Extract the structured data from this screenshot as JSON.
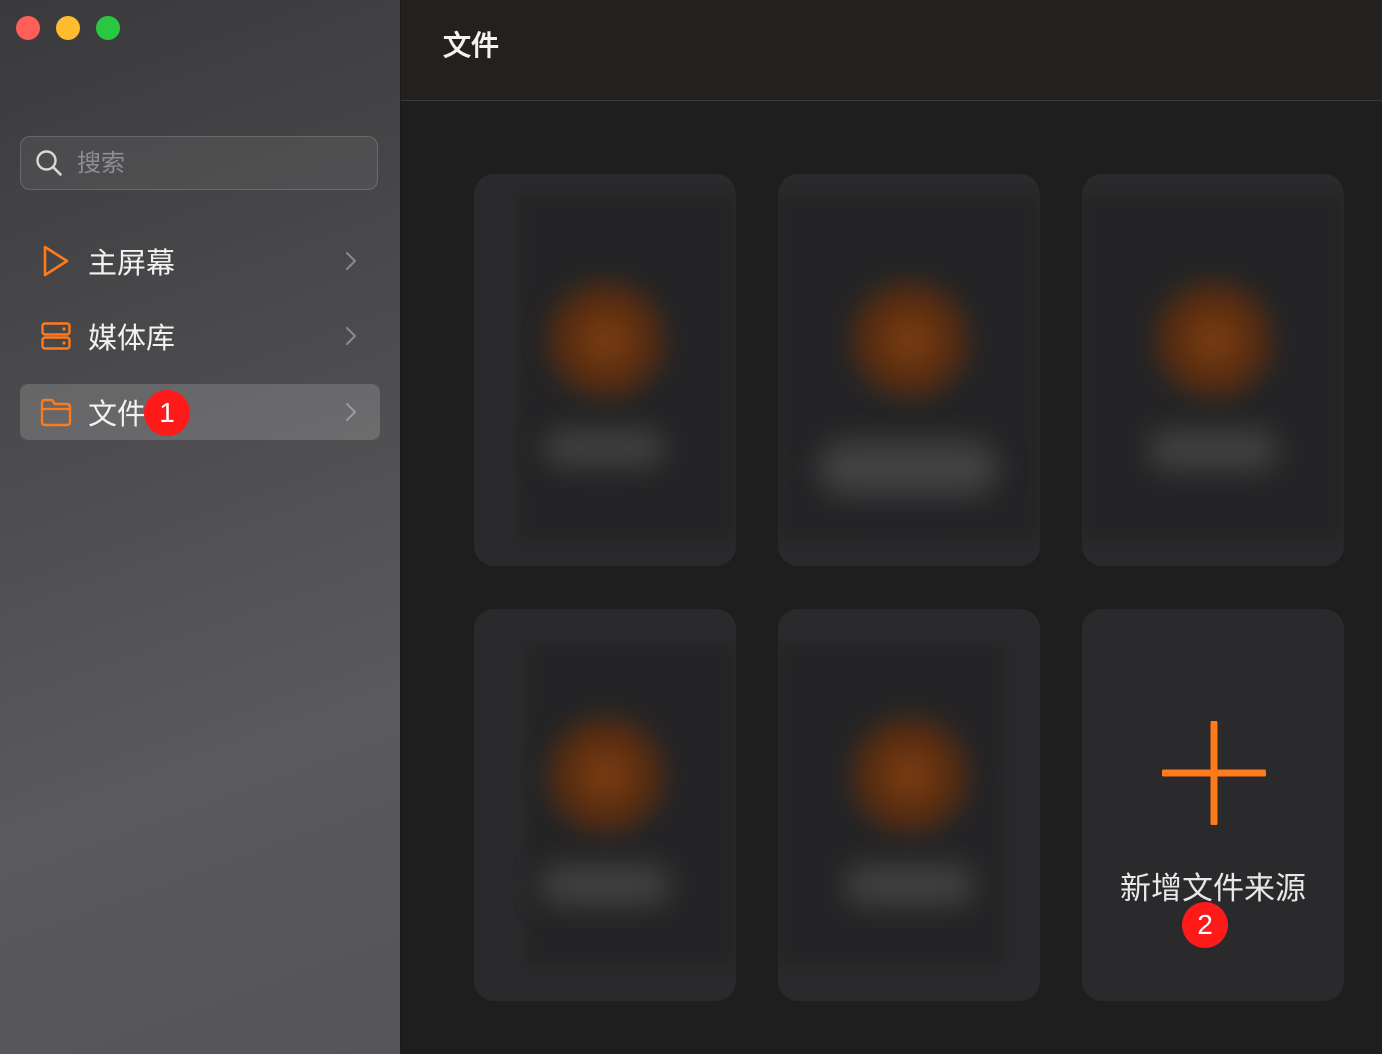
{
  "sidebar": {
    "search": {
      "placeholder": "搜索"
    },
    "items": [
      {
        "label": "主屏幕",
        "icon": "play-triangle-icon"
      },
      {
        "label": "媒体库",
        "icon": "server-stack-icon"
      },
      {
        "label": "文件",
        "icon": "folder-icon",
        "active": true
      }
    ]
  },
  "header": {
    "title": "文件"
  },
  "main": {
    "add_source_label": "新增文件来源"
  },
  "annotations": {
    "badge_1": "1",
    "badge_2": "2"
  },
  "colors": {
    "accent": "#ff7a1a",
    "badge": "#ff1a1a"
  }
}
